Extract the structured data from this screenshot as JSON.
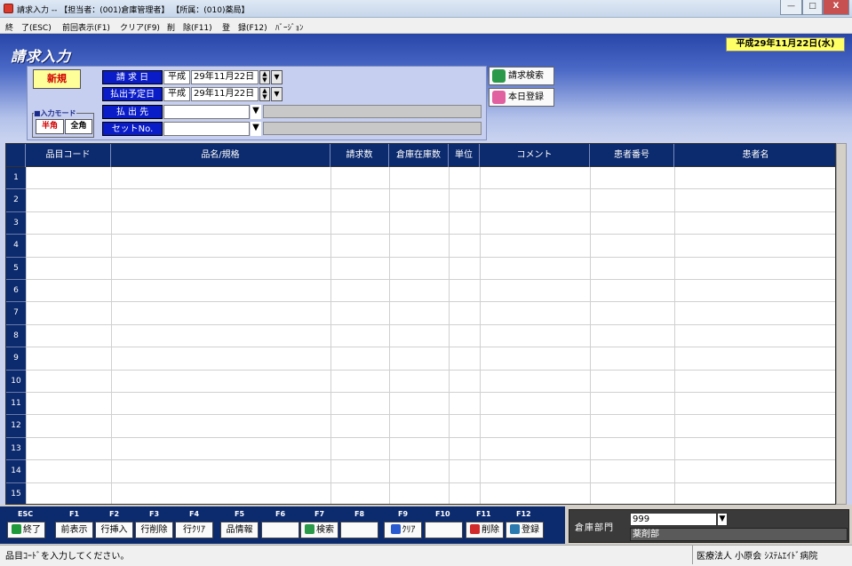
{
  "window": {
    "title": "請求入力 -- 【担当者：(001)倉庫管理者】 【所属：(010)薬局】",
    "min_symbol": "—",
    "max_symbol": "□",
    "close_symbol": "X"
  },
  "menu": {
    "items": [
      "終　了(ESC)",
      "前回表示(F1)",
      "クリア(F9)",
      "削　除(F11)",
      "登　録(F12)",
      "ﾊﾞｰｼﾞｮﾝ"
    ]
  },
  "header": {
    "app_title": "請求入力",
    "current_date": "平成29年11月22日(水)",
    "new_badge": "新規",
    "input_mode_label": "■入力モード",
    "mode_half": "半角",
    "mode_full": "全角"
  },
  "form": {
    "request_date_label": "請 求 日",
    "request_era": "平成",
    "request_date": "29年11月22日",
    "payout_date_label": "払出予定日",
    "payout_era": "平成",
    "payout_date": "29年11月22日",
    "payout_dest_label": "払 出 先",
    "payout_dest_value": "",
    "set_no_label": "セットNo.",
    "set_no_value": "",
    "dropdown_glyph": "▼",
    "spin_up": "▲",
    "spin_down": "▼"
  },
  "actions": {
    "search_label": "請求検索",
    "today_label": "本日登録"
  },
  "grid": {
    "columns": [
      "品目コード",
      "品名/規格",
      "請求数",
      "倉庫在庫数",
      "単位",
      "コメント",
      "患者番号",
      "患者名"
    ],
    "row_numbers": [
      "1",
      "2",
      "3",
      "4",
      "5",
      "6",
      "7",
      "8",
      "9",
      "10",
      "11",
      "12",
      "13",
      "14",
      "15"
    ]
  },
  "function_keys": [
    {
      "key": "ESC",
      "label": "終了",
      "icon": "exit-icon",
      "color": "#1e9a3a"
    },
    {
      "key": "F1",
      "label": "前表示",
      "icon": "",
      "color": ""
    },
    {
      "key": "F2",
      "label": "行挿入",
      "icon": "",
      "color": ""
    },
    {
      "key": "F3",
      "label": "行削除",
      "icon": "",
      "color": ""
    },
    {
      "key": "F4",
      "label": "行ｸﾘｱ",
      "icon": "",
      "color": ""
    },
    {
      "key": "F5",
      "label": "品情報",
      "icon": "",
      "color": ""
    },
    {
      "key": "F6",
      "label": "",
      "icon": "",
      "color": ""
    },
    {
      "key": "F7",
      "label": "検索",
      "icon": "search-icon",
      "color": "#2a9a4a"
    },
    {
      "key": "F8",
      "label": "",
      "icon": "",
      "color": ""
    },
    {
      "key": "F9",
      "label": "ｸﾘｱ",
      "icon": "clear-icon",
      "color": "#2a5ad0"
    },
    {
      "key": "F10",
      "label": "",
      "icon": "",
      "color": ""
    },
    {
      "key": "F11",
      "label": "削除",
      "icon": "delete-icon",
      "color": "#d02a2a"
    },
    {
      "key": "F12",
      "label": "登録",
      "icon": "register-icon",
      "color": "#2a7ab0"
    }
  ],
  "dept": {
    "label": "倉庫部門",
    "code": "999",
    "name": "薬剤部"
  },
  "status": {
    "message": "品目ｺｰﾄﾞを入力してください。",
    "organization": "医療法人 小原会 ｼｽﾃﾑｴｲﾄﾞ病院"
  },
  "colors": {
    "header_blue": "#0c2a6e",
    "label_blue": "#0a1cc8",
    "date_yellow": "#ffff66",
    "new_text_red": "#d00000"
  }
}
